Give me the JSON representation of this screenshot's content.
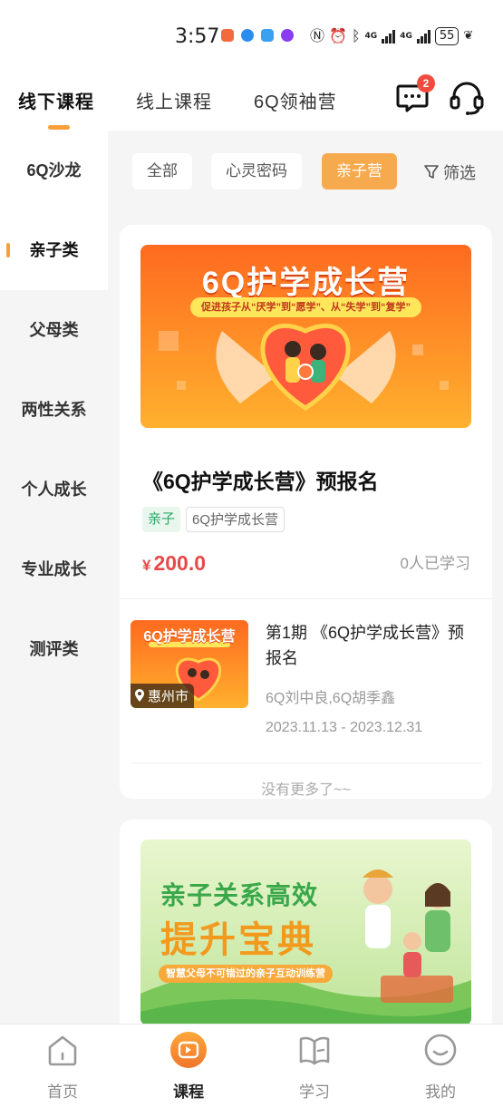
{
  "status_bar": {
    "time": "3:57",
    "network_1": "4G",
    "network_2": "4G",
    "battery": "55"
  },
  "top_tabs": [
    {
      "label": "线下课程",
      "active": true
    },
    {
      "label": "线上课程",
      "active": false
    },
    {
      "label": "6Q领袖营",
      "active": false
    }
  ],
  "header": {
    "message_badge": "2",
    "message_icon": "message-icon",
    "support_icon": "headset-icon"
  },
  "sidebar": {
    "salon": "6Q沙龙",
    "items": [
      {
        "label": "亲子类",
        "active": true
      },
      {
        "label": "父母类",
        "active": false
      },
      {
        "label": "两性关系",
        "active": false
      },
      {
        "label": "个人成长",
        "active": false
      },
      {
        "label": "专业成长",
        "active": false
      },
      {
        "label": "测评类",
        "active": false
      }
    ]
  },
  "filters": {
    "chips": [
      {
        "label": "全部",
        "active": false
      },
      {
        "label": "心灵密码",
        "active": false
      },
      {
        "label": "亲子营",
        "active": true
      }
    ],
    "filter_label": "筛选"
  },
  "course": {
    "banner_title": "6Q护学成长营",
    "banner_subtitle": "促进孩子从“厌学”到“愿学”、从“失学”到“复学”",
    "title": "《6Q护学成长营》预报名",
    "tags": [
      "亲子",
      "6Q护学成长营"
    ],
    "currency": "¥",
    "price": "200.0",
    "learners": "0人已学习",
    "session": {
      "thumb_title": "6Q护学成长营",
      "location": "惠州市",
      "title": "第1期 《6Q护学成长营》预报名",
      "teachers": "6Q刘中良,6Q胡季鑫",
      "dates": "2023.11.13 - 2023.12.31"
    },
    "no_more": "没有更多了~~"
  },
  "course2": {
    "banner_line1": "亲子关系高效",
    "banner_line2": "提升宝典",
    "banner_sub": "智慧父母不可错过的亲子互动训练营"
  },
  "bottom_nav": [
    {
      "label": "首页",
      "icon": "home-icon",
      "active": false
    },
    {
      "label": "课程",
      "icon": "play-icon",
      "active": true
    },
    {
      "label": "学习",
      "icon": "book-icon",
      "active": false
    },
    {
      "label": "我的",
      "icon": "profile-icon",
      "active": false
    }
  ],
  "colors": {
    "accent": "#f7a03a",
    "price": "#e54a4a",
    "tag_green": "#2fa765",
    "badge": "#f04b3d"
  }
}
